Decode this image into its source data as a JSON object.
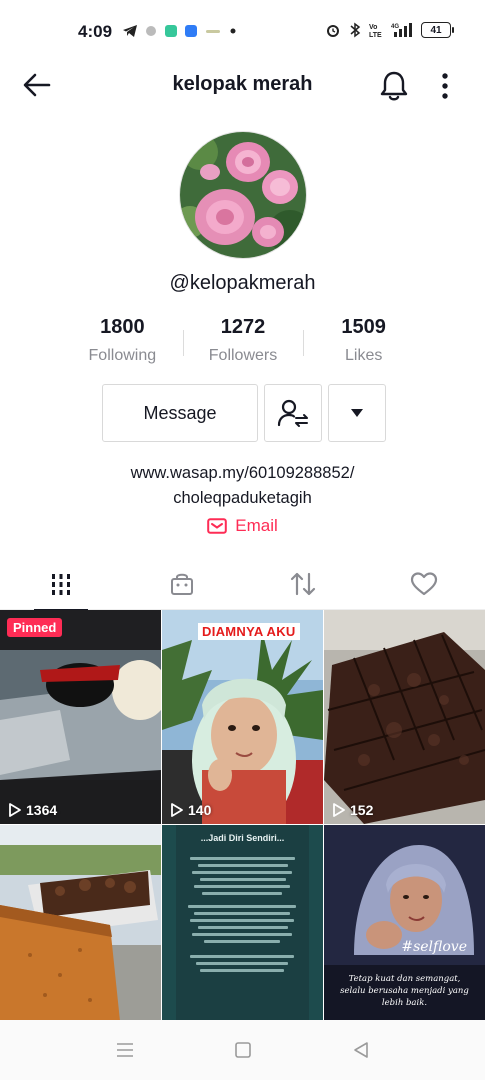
{
  "status_bar": {
    "time": "4:09",
    "battery": "41"
  },
  "header": {
    "title": "kelopak merah",
    "back_icon": "arrow-left-icon",
    "bell_icon": "bell-icon",
    "more_icon": "more-vertical-icon"
  },
  "profile": {
    "username": "@kelopakmerah",
    "stats": [
      {
        "value": "1800",
        "label": "Following"
      },
      {
        "value": "1272",
        "label": "Followers"
      },
      {
        "value": "1509",
        "label": "Likes"
      }
    ],
    "message_label": "Message",
    "bio_line1": "www.wasap.my/60109288852/",
    "bio_line2": "choleqpaduketagih",
    "email_label": "Email"
  },
  "tabs": [
    {
      "icon": "videos-grid-icon",
      "active": true
    },
    {
      "icon": "shop-bag-icon",
      "active": false
    },
    {
      "icon": "repost-icon",
      "active": false
    },
    {
      "icon": "heart-icon",
      "active": false
    }
  ],
  "videos": [
    {
      "views": "1364",
      "badge": "Pinned"
    },
    {
      "views": "140",
      "caption": "DIAMNYA AKU"
    },
    {
      "views": "152"
    },
    {
      "views": ""
    },
    {
      "views": "",
      "title": "...Jadi Diri Sendiri..."
    },
    {
      "views": "",
      "tag": "#selflove",
      "quote": "Tetap kuat dan semangat, selalu berusaha menjadi yang lebih baik."
    }
  ],
  "colors": {
    "accent": "#fe2c55",
    "text": "#161823",
    "muted": "#8a8b91"
  }
}
